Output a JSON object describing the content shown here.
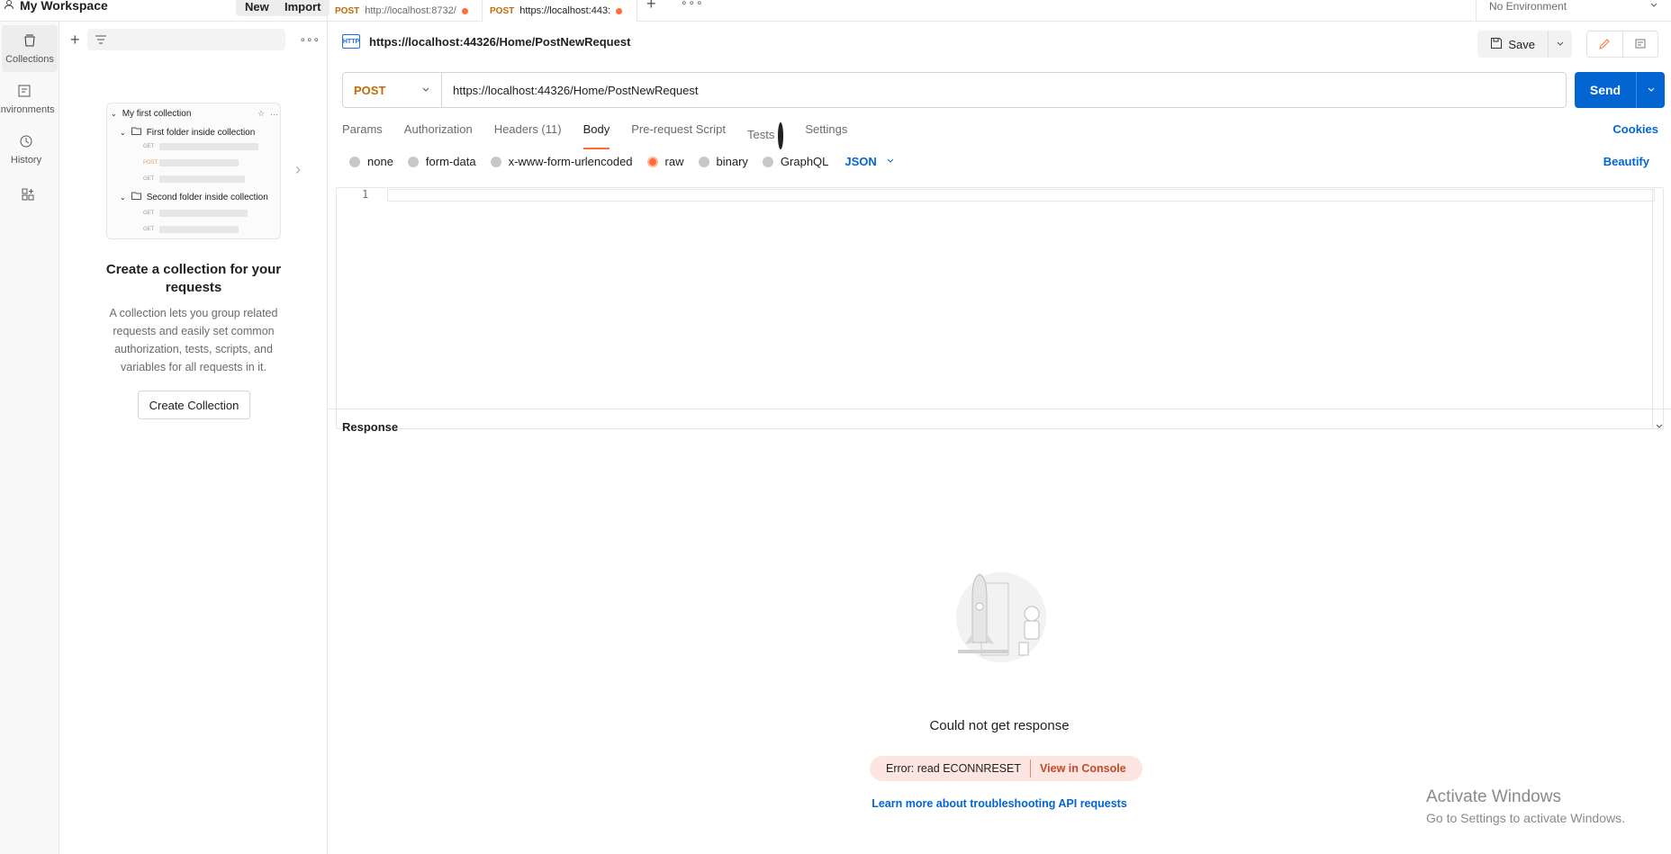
{
  "workspace": {
    "title": "My Workspace",
    "new_label": "New",
    "import_label": "Import"
  },
  "tabs": [
    {
      "method": "POST",
      "label": "http://localhost:8732/"
    },
    {
      "method": "POST",
      "label": "https://localhost:443:"
    }
  ],
  "environment": {
    "selected": "No Environment"
  },
  "rail": {
    "collections": "Collections",
    "environments": "Environments",
    "history": "History"
  },
  "sidebar": {
    "illustration": {
      "collection": "My first collection",
      "folder1": "First folder inside collection",
      "folder2": "Second folder inside collection",
      "method_get": "GET",
      "method_post": "POST"
    },
    "heading": "Create a collection for your requests",
    "description": "A collection lets you group related requests and easily set common authorization, tests, scripts, and variables for all requests in it.",
    "create_label": "Create Collection"
  },
  "request": {
    "title": "https://localhost:44326/Home/PostNewRequest",
    "http_badge": "HTTP",
    "save_label": "Save",
    "method": "POST",
    "url": "https://localhost:44326/Home/PostNewRequest",
    "send_label": "Send",
    "tabs": [
      "Params",
      "Authorization",
      "Headers (11)",
      "Body",
      "Pre-request Script",
      "Tests",
      "Settings"
    ],
    "cookies_label": "Cookies",
    "body_options": [
      "none",
      "form-data",
      "x-www-form-urlencoded",
      "raw",
      "binary",
      "GraphQL"
    ],
    "body_selected": "raw",
    "format": "JSON",
    "beautify_label": "Beautify",
    "line_number": "1"
  },
  "response": {
    "title": "Response",
    "message": "Could not get response",
    "error": "Error: read ECONNRESET",
    "view_console": "View in Console",
    "learn_link": "Learn more about troubleshooting API requests"
  },
  "watermark": {
    "title": "Activate Windows",
    "subtitle": "Go to Settings to activate Windows."
  },
  "colors": {
    "accent": "#ff6c37",
    "primary": "#0265d2",
    "method_post": "#c16a06"
  }
}
